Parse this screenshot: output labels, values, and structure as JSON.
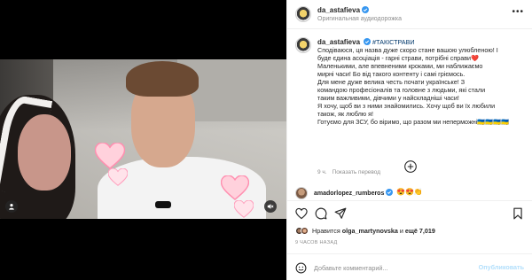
{
  "header": {
    "username": "da_astafieva",
    "audio_label": "Оригинальная аудиодорожка",
    "more_icon": "more-horizontal-icon"
  },
  "caption": {
    "username": "da_astafieva",
    "hashtag": "#ТАКІСТРАВИ",
    "lines": [
      "Сподіваюся, ця назва дуже скоро стане вашою улюбленою! І",
      "буде єдина асоціація - гарні страви, потрібні справи❤️",
      "Маленькими, але впевненими кроками, ми наближаємо",
      "мирні часи! Бо від такого контенту і самі гріємось.",
      "Для мене дуже велика честь почати українське! З",
      "командою професіоналів та головне з людьми, які стали",
      "таким важливими, дівчими у найскладніші часи!",
      "Я хочу, щоб ви з ними знайомились. Хочу щоб ви їх любили",
      "також, як люблю я!",
      "Готуємо для ЗСУ, бо віримо, що разом ми неперможні🇺🇦🇺🇦🇺🇦🇺🇦"
    ],
    "age": "9 ч.",
    "translate": "Показать перевод"
  },
  "comment": {
    "username": "amadorlopez_rumberos",
    "text": "😍😍👏"
  },
  "likes": {
    "prefix": "Нравится",
    "user": "olga_martynovska",
    "middle": "и",
    "count": "ещё 7,019"
  },
  "time_ago": "9 ЧАСОВ НАЗАД",
  "add_comment": {
    "placeholder": "Добавьте комментарий...",
    "post_label": "Опубликовать"
  },
  "colors": {
    "link": "#00376b",
    "muted": "#8e8e8e",
    "post_disabled": "#b2dffc",
    "verified": "#3897f0",
    "heart": "#ffb3c7"
  }
}
